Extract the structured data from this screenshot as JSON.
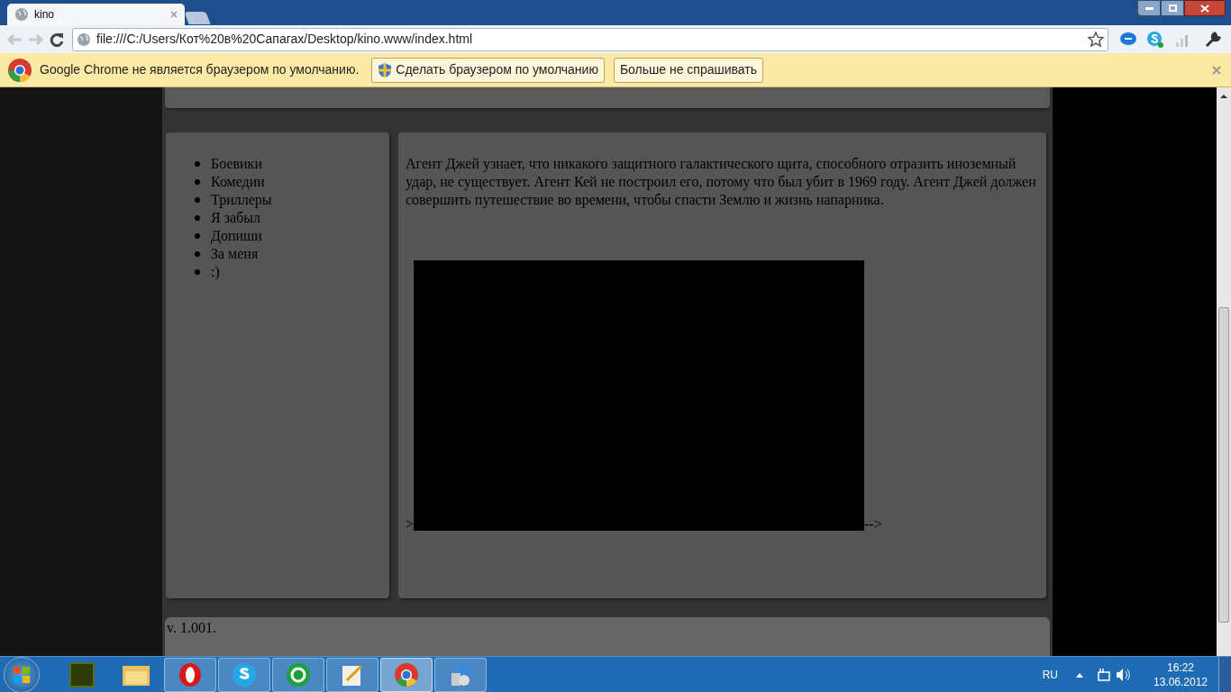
{
  "browser": {
    "tabs": [
      {
        "title": "kino",
        "selected": true
      }
    ],
    "url": "file:///C:/Users/Кот%20в%20Сапагах/Desktop/kino.www/index.html"
  },
  "infobar": {
    "message": "Google Chrome не является браузером по умолчанию.",
    "buttons": [
      "Сделать браузером по умолчанию",
      "Больше не спрашивать"
    ]
  },
  "page": {
    "sidebar": {
      "items": [
        "Боевики",
        "Комедии",
        "Триллеры",
        "Я забыл",
        "Допиши",
        "За меня",
        ":)"
      ]
    },
    "description": "Агент Джей узнает, что никакого защитного галактического щита, способного отразить иноземный удар, не существует. Агент Кей не построил его, потому что был убит в 1969 году. Агент Джей должен совершить путешествие во времени, чтобы спасти Землю и жизнь напарника.",
    "video": {
      "before": ">",
      "after": "-->"
    },
    "footer": "v. 1.001."
  },
  "taskbar": {
    "language": "RU",
    "time": "16:22",
    "date": "13.06.2012"
  }
}
